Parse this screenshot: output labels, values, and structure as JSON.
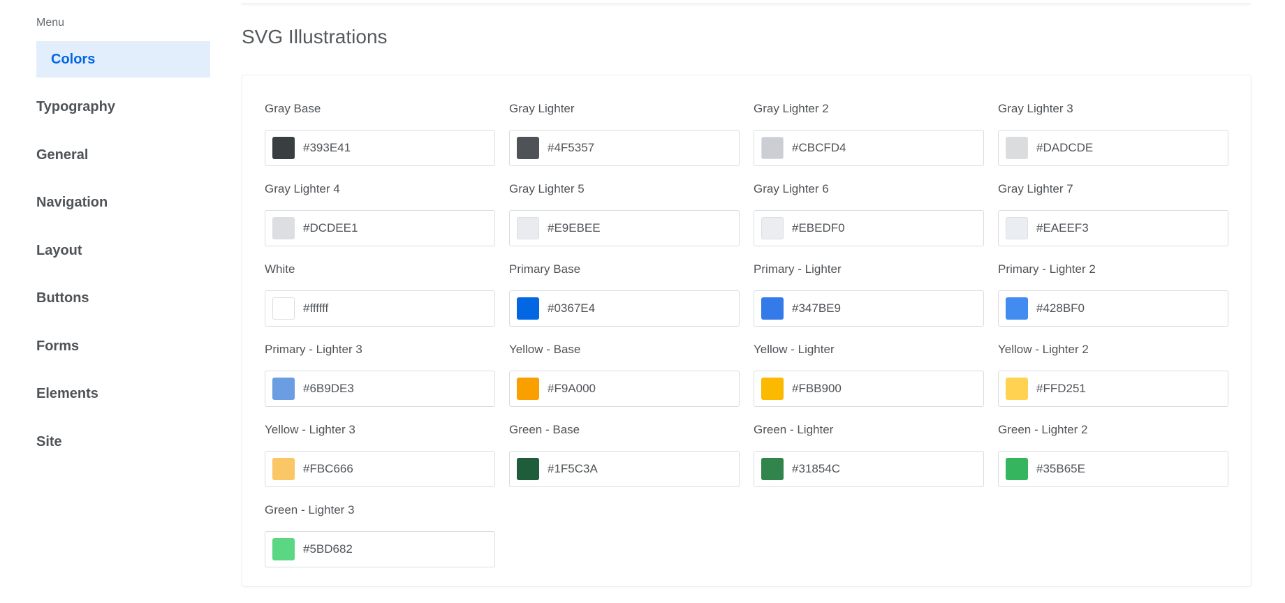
{
  "sidebar": {
    "menu_title": "Menu",
    "items": [
      {
        "label": "Colors",
        "active": true
      },
      {
        "label": "Typography",
        "active": false
      },
      {
        "label": "General",
        "active": false
      },
      {
        "label": "Navigation",
        "active": false
      },
      {
        "label": "Layout",
        "active": false
      },
      {
        "label": "Buttons",
        "active": false
      },
      {
        "label": "Forms",
        "active": false
      },
      {
        "label": "Elements",
        "active": false
      },
      {
        "label": "Site",
        "active": false
      }
    ]
  },
  "main": {
    "section_title": "SVG Illustrations",
    "swatches": [
      {
        "label": "Gray Base",
        "hex": "#393E41",
        "color": "#393E41"
      },
      {
        "label": "Gray Lighter",
        "hex": "#4F5357",
        "color": "#4F5357"
      },
      {
        "label": "Gray Lighter 2",
        "hex": "#CBCFD4",
        "color": "#CBCFD4"
      },
      {
        "label": "Gray Lighter 3",
        "hex": "#DADCDE",
        "color": "#DADCDE"
      },
      {
        "label": "Gray Lighter 4",
        "hex": "#DCDEE1",
        "color": "#DCDEE1"
      },
      {
        "label": "Gray Lighter 5",
        "hex": "#E9EBEE",
        "color": "#E9EBEE"
      },
      {
        "label": "Gray Lighter 6",
        "hex": "#EBEDF0",
        "color": "#EBEDF0"
      },
      {
        "label": "Gray Lighter 7",
        "hex": "#EAEEF3",
        "color": "#EAEEF3"
      },
      {
        "label": "White",
        "hex": "#ffffff",
        "color": "#ffffff"
      },
      {
        "label": "Primary Base",
        "hex": "#0367E4",
        "color": "#0367E4"
      },
      {
        "label": "Primary - Lighter",
        "hex": "#347BE9",
        "color": "#347BE9"
      },
      {
        "label": "Primary - Lighter 2",
        "hex": "#428BF0",
        "color": "#428BF0"
      },
      {
        "label": "Primary - Lighter 3",
        "hex": "#6B9DE3",
        "color": "#6B9DE3"
      },
      {
        "label": "Yellow - Base",
        "hex": "#F9A000",
        "color": "#F9A000"
      },
      {
        "label": "Yellow - Lighter",
        "hex": "#FBB900",
        "color": "#FBB900"
      },
      {
        "label": "Yellow - Lighter 2",
        "hex": "#FFD251",
        "color": "#FFD251"
      },
      {
        "label": "Yellow - Lighter 3",
        "hex": "#FBC666",
        "color": "#FBC666"
      },
      {
        "label": "Green - Base",
        "hex": "#1F5C3A",
        "color": "#1F5C3A"
      },
      {
        "label": "Green - Lighter",
        "hex": "#31854C",
        "color": "#31854C"
      },
      {
        "label": "Green - Lighter 2",
        "hex": "#35B65E",
        "color": "#35B65E"
      },
      {
        "label": "Green - Lighter 3",
        "hex": "#5BD682",
        "color": "#5BD682"
      }
    ]
  }
}
